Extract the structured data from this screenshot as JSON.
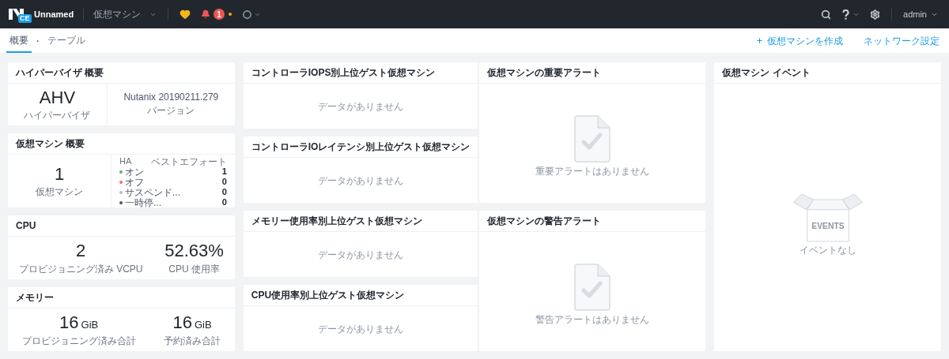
{
  "topbar": {
    "logo_badge": "CE",
    "cluster": "Unnamed",
    "entity_menu": "仮想マシン",
    "alert_count": "1",
    "user": "admin"
  },
  "tab_separator": "·",
  "tabs": [
    {
      "label": "概要",
      "selected": true
    },
    {
      "label": "テーブル",
      "selected": false
    }
  ],
  "actions": [
    {
      "label": "仮想マシンを作成",
      "kind": "add"
    },
    {
      "label": "ネットワーク設定",
      "kind": "link"
    }
  ],
  "hypervisor_summary": {
    "title": "ハイパーバイザ 概要",
    "stats": [
      {
        "value": "AHV",
        "label": "ハイパーバイザ",
        "kind": "large"
      },
      {
        "value": "Nutanix 20190211.279",
        "label": "バージョン",
        "kind": "small"
      }
    ]
  },
  "vm_summary": {
    "title": "仮想マシン 概要",
    "count": "1",
    "count_label": "仮想マシン",
    "ha_header": "HA",
    "ha_mode": "ベストエフォート",
    "states": [
      {
        "label": "オン",
        "value": "1",
        "color": "#44c15a"
      },
      {
        "label": "オフ",
        "value": "0",
        "color": "#f26b6b"
      },
      {
        "label": "サスペンド...",
        "value": "0",
        "color": "#b4bac4"
      },
      {
        "label": "一時停...",
        "value": "0",
        "color": "#4b556a"
      }
    ]
  },
  "cpu": {
    "title": "CPU",
    "stats": [
      {
        "value": "2",
        "label": "プロビジョニング済み VCPU",
        "kind": "large"
      },
      {
        "value": "52.63%",
        "label": "CPU 使用率",
        "kind": "large"
      }
    ]
  },
  "memory": {
    "title": "メモリー",
    "stats": [
      {
        "value": "16",
        "unit": "GiB",
        "label": "プロビジョニング済み合計",
        "kind": "large"
      },
      {
        "value": "16",
        "unit": "GiB",
        "label": "予約済み合計",
        "kind": "large"
      }
    ]
  },
  "top_vm_widgets": [
    {
      "title": "コントローラIOPS別上位ゲスト仮想マシン",
      "empty_text": "データがありません"
    },
    {
      "title": "コントローラIOレイテンシ別上位ゲスト仮想マシン",
      "empty_text": "データがありません"
    },
    {
      "title": "メモリー使用率別上位ゲスト仮想マシン",
      "empty_text": "データがありません"
    },
    {
      "title": "CPU使用率別上位ゲスト仮想マシン",
      "empty_text": "データがありません"
    }
  ],
  "alert_widgets": [
    {
      "title": "仮想マシンの重要アラート",
      "empty_text": "重要アラートはありません"
    },
    {
      "title": "仮想マシンの警告アラート",
      "empty_text": "警告アラートはありません"
    }
  ],
  "events": {
    "title": "仮想マシン イベント",
    "empty_text": "イベントなし",
    "box_label": "EVENTS"
  }
}
